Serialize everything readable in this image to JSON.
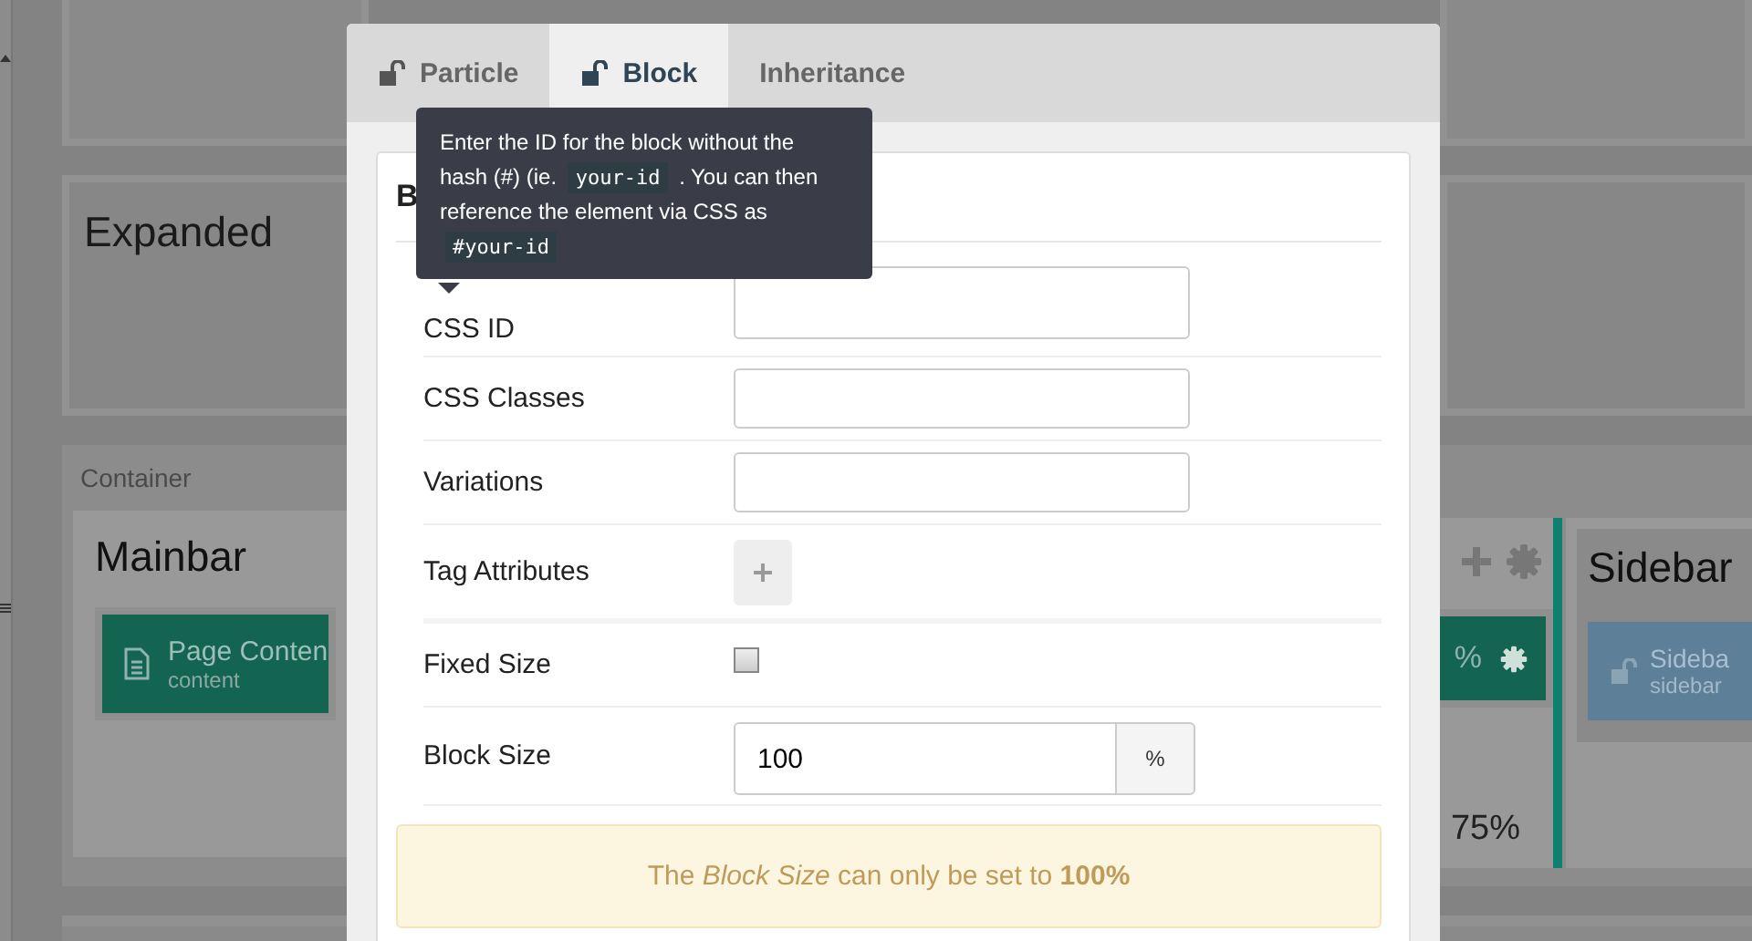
{
  "background": {
    "left": {
      "expanded_title": "Expanded",
      "container_label": "Container",
      "mainbar_title": "Mainbar",
      "block_title": "Page Conten",
      "block_subtitle": "content"
    },
    "right": {
      "block_size_suffix": "%",
      "mainbar_size": "75%",
      "sidebar_title": "Sidebar",
      "sidebar_block_title": "Sideba",
      "sidebar_block_subtitle": "sidebar"
    }
  },
  "modal": {
    "tabs": [
      {
        "label": "Particle",
        "selected": false,
        "kind": "locked"
      },
      {
        "label": "Block",
        "selected": true,
        "kind": "locked"
      },
      {
        "label": "Inheritance",
        "selected": false,
        "kind": "plain"
      }
    ],
    "card_title": "B",
    "tooltip": {
      "parts": [
        {
          "kind": "text",
          "text": "Enter the ID for the block without the hash (#) (ie."
        },
        {
          "kind": "code",
          "text": "your-id"
        },
        {
          "kind": "text",
          "text": ". You can then reference the element via CSS as"
        },
        {
          "kind": "code",
          "text": "#your-id"
        }
      ]
    },
    "fields": [
      {
        "kind": "input",
        "label": "CSS ID"
      },
      {
        "kind": "input",
        "label": "CSS Classes"
      },
      {
        "kind": "input",
        "label": "Variations"
      },
      {
        "kind": "add",
        "label": "Tag Attributes"
      },
      {
        "kind": "checkbox",
        "label": "Fixed Size",
        "checked": false
      },
      {
        "kind": "addon",
        "label": "Block Size",
        "value": "100",
        "addon": "%"
      }
    ],
    "alert": "The *Block Size* can only be set to **100%**"
  }
}
